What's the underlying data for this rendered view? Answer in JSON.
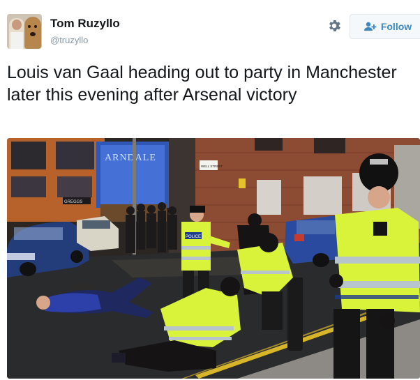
{
  "author": {
    "display_name": "Tom Ruzyllo",
    "handle": "@truzyllo",
    "avatar_icon": "profile-photo-with-dog"
  },
  "actions": {
    "settings_icon": "gear-icon",
    "follow_label": "Follow",
    "follow_icon": "follow-person-plus-icon"
  },
  "tweet": {
    "text": "Louis van Gaal heading out to party in Manchester later this evening after Arsenal victory"
  },
  "photo": {
    "description": "street-night-police-scene",
    "sign_text": "ARNDALE",
    "street_sign": "WELL STREET",
    "police_badge": "POLICE",
    "shop_sign": "GREGGS",
    "accent_hiviz": "#d9f23a",
    "accent_blue": "#3b88c3"
  }
}
